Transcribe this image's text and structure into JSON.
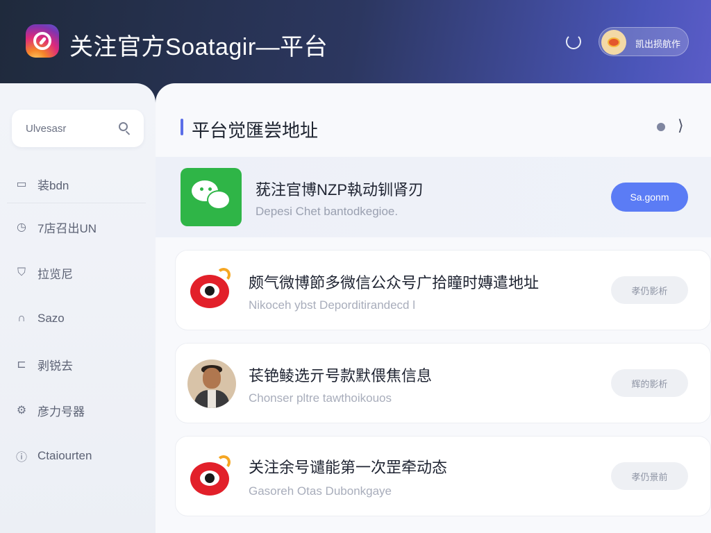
{
  "header": {
    "app_title": "关注官方Soatagir—平台",
    "user_name": "凯出损航作"
  },
  "sidebar": {
    "search_value": "Ulvesasr",
    "items": [
      {
        "label": "装bdn",
        "icon": "document-icon"
      },
      {
        "label": "7店召出UN",
        "icon": "clock-icon"
      },
      {
        "label": "拉览尼",
        "icon": "shield-icon"
      },
      {
        "label": "Sazo",
        "icon": "lock-icon"
      },
      {
        "label": "剥锐去",
        "icon": "folder-icon"
      },
      {
        "label": "彦力号器",
        "icon": "gear-icon"
      },
      {
        "label": "Ctaiourten",
        "icon": "info-icon"
      }
    ]
  },
  "content": {
    "title": "平台觉匯尝地址",
    "cards": [
      {
        "title": "莸注官博NZP執动钏肾刃",
        "subtitle": "Depesi Chet bantodkegioe.",
        "button": "Sa.gonm",
        "icon": "wechat-icon"
      },
      {
        "title": "颇气微博節多微信公众号广拾瞳时嫥遣地址",
        "subtitle": "Nikoceh ybst Deporditirandecd l",
        "button": "孝仍影析",
        "icon": "weibo-icon"
      },
      {
        "title": "苌铯鲮选亓号款默偎焦信息",
        "subtitle": "Chonser pltre tawthoikouos",
        "button": "辉的影析",
        "icon": "avatar"
      },
      {
        "title": "关注余号谴能第一次罡牵动态",
        "subtitle": "Gasoreh Otas Dubonkgaye",
        "button": "孝仍景前",
        "icon": "weibo-icon"
      }
    ]
  },
  "colors": {
    "accent": "#5b7cf5",
    "wechat_green": "#2fb547",
    "weibo_red": "#e2202a"
  }
}
